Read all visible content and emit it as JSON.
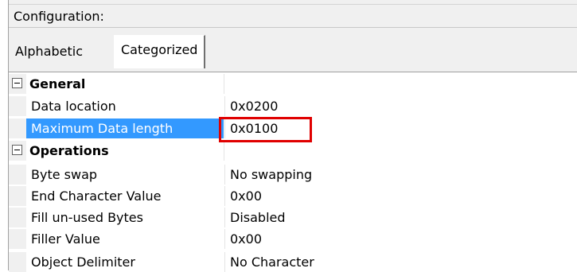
{
  "header": {
    "title": "Configuration:"
  },
  "tabs": [
    {
      "label": "Alphabetic",
      "active": false
    },
    {
      "label": "Categorized",
      "active": true
    }
  ],
  "categories": [
    {
      "label": "General",
      "collapse_icon": "minus-box-icon",
      "properties": [
        {
          "name": "Data location",
          "value": "0x0200",
          "selected": false
        },
        {
          "name": "Maximum Data length",
          "value": "0x0100",
          "selected": true
        }
      ]
    },
    {
      "label": "Operations",
      "collapse_icon": "minus-box-icon",
      "properties": [
        {
          "name": "Byte swap",
          "value": "No swapping",
          "selected": false
        },
        {
          "name": "End Character Value",
          "value": "0x00",
          "selected": false
        },
        {
          "name": "Fill un-used Bytes",
          "value": "Disabled",
          "selected": false
        },
        {
          "name": "Filler Value",
          "value": "0x00",
          "selected": false
        },
        {
          "name": "Object Delimiter",
          "value": "No Character",
          "selected": false
        }
      ]
    }
  ],
  "colors": {
    "selection": "#3399ff",
    "annotation_box": "#e00000"
  }
}
